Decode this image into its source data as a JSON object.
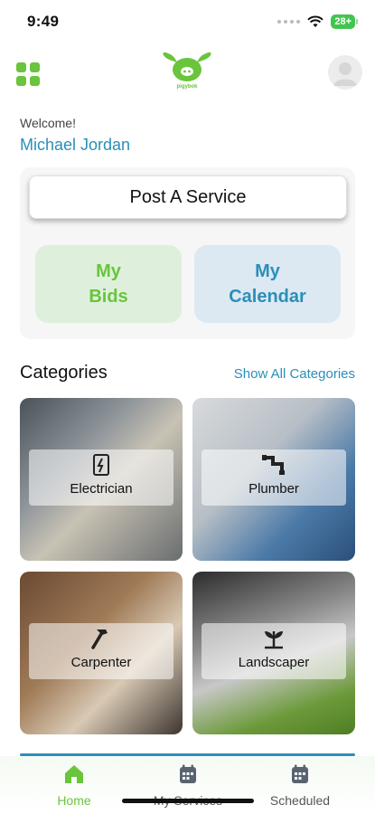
{
  "status": {
    "time": "9:49",
    "battery": "28+"
  },
  "header": {
    "logo_text": "pigybok"
  },
  "welcome": {
    "greeting": "Welcome!",
    "name": "Michael Jordan"
  },
  "actions": {
    "post_service": "Post A Service",
    "my_bids_line1": "My",
    "my_bids_line2": "Bids",
    "my_calendar_line1": "My",
    "my_calendar_line2": "Calendar"
  },
  "categories": {
    "title": "Categories",
    "show_all": "Show All Categories",
    "items": [
      {
        "label": "Electrician",
        "icon": "electric-panel-icon"
      },
      {
        "label": "Plumber",
        "icon": "pipe-faucet-icon"
      },
      {
        "label": "Carpenter",
        "icon": "hammer-icon"
      },
      {
        "label": "Landscaper",
        "icon": "plant-icon"
      }
    ]
  },
  "tabbar": {
    "home": "Home",
    "my_services": "My Services",
    "scheduled": "Scheduled"
  },
  "colors": {
    "accent_green": "#6ac43c",
    "accent_blue": "#2a8fb8",
    "bids_bg": "#def0dc",
    "calendar_bg": "#dce9f3"
  }
}
